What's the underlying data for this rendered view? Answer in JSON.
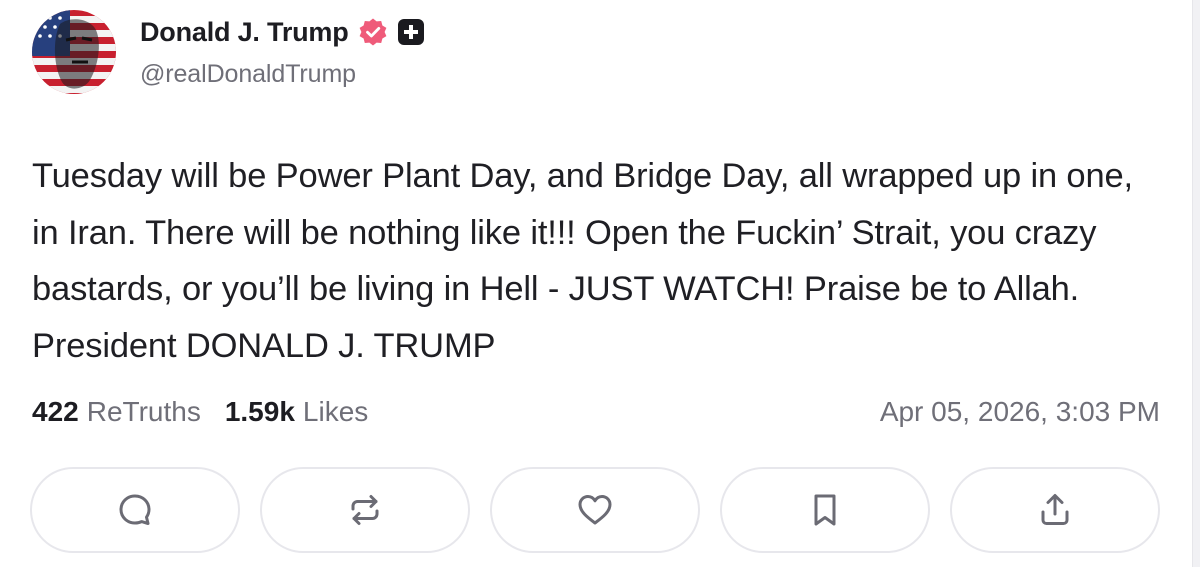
{
  "author": {
    "display_name": "Donald J. Trump",
    "handle": "@realDonaldTrump",
    "avatar_icon": "avatar-image",
    "verified_icon": "verified-badge-icon",
    "verified_color": "#ef5b7a",
    "plus_badge_icon": "truth-plus-icon"
  },
  "post": {
    "text": "Tuesday will be Power Plant Day, and Bridge Day, all wrapped up in one, in Iran. There will be nothing like it!!! Open the Fuckin’ Strait, you crazy bastards, or you’ll be living in Hell - JUST WATCH! Praise be to Allah. President DONALD J. TRUMP"
  },
  "stats": {
    "retruths_count": "422",
    "retruths_label": "ReTruths",
    "likes_count": "1.59k",
    "likes_label": "Likes",
    "timestamp": "Apr 05, 2026, 3:03 PM"
  },
  "actions": [
    {
      "name": "reply",
      "icon": "comment-icon"
    },
    {
      "name": "retruth",
      "icon": "repost-icon"
    },
    {
      "name": "like",
      "icon": "heart-icon"
    },
    {
      "name": "bookmark",
      "icon": "bookmark-icon"
    },
    {
      "name": "share",
      "icon": "share-icon"
    }
  ],
  "colors": {
    "text": "#1f1f24",
    "muted": "#6f6f78",
    "border": "#e7e7ec",
    "icon": "#6b6b74"
  }
}
